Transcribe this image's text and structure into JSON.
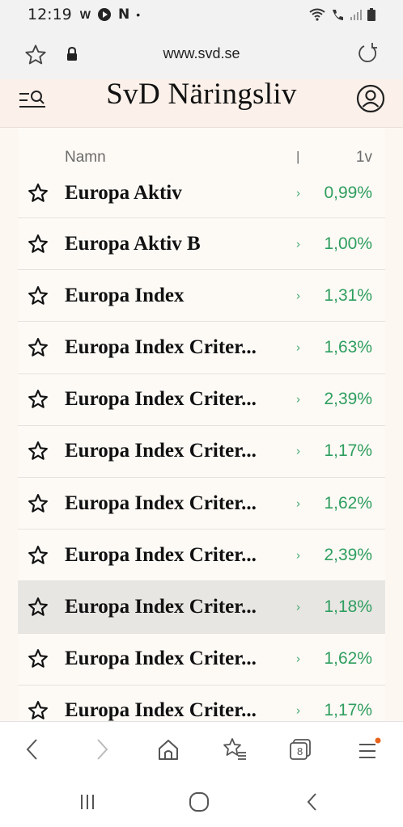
{
  "status_bar": {
    "time": "12:19",
    "notification_icons": [
      "w-icon",
      "play-icon",
      "n-icon",
      "dot-icon"
    ]
  },
  "browser": {
    "url": "www.svd.se",
    "tab_count": "8"
  },
  "site": {
    "logo": "SvD Näringsliv"
  },
  "table": {
    "col_name": "Namn",
    "col_mid": "|",
    "col_1v": "1v",
    "rows": [
      {
        "name": "Europa Aktiv",
        "mid": "›",
        "value": "0,99%"
      },
      {
        "name": "Europa Aktiv B",
        "mid": "›",
        "value": "1,00%"
      },
      {
        "name": "Europa Index",
        "mid": "›",
        "value": "1,31%"
      },
      {
        "name": "Europa Index Criter...",
        "mid": "›",
        "value": "1,63%"
      },
      {
        "name": "Europa Index Criter...",
        "mid": "›",
        "value": "2,39%"
      },
      {
        "name": "Europa Index Criter...",
        "mid": "›",
        "value": "1,17%"
      },
      {
        "name": "Europa Index Criter...",
        "mid": "›",
        "value": "1,62%"
      },
      {
        "name": "Europa Index Criter...",
        "mid": "›",
        "value": "2,39%"
      },
      {
        "name": "Europa Index Criter...",
        "mid": "›",
        "value": "1,18%"
      },
      {
        "name": "Europa Index Criter...",
        "mid": "›",
        "value": "1,62%"
      },
      {
        "name": "Europa Index Criter...",
        "mid": "›",
        "value": "1,17%"
      }
    ]
  },
  "colors": {
    "positive": "#2e9e5e",
    "header_bg": "#fbf1ea",
    "highlight_row": "#e7e6e3",
    "menu_badge": "#e8641e"
  }
}
